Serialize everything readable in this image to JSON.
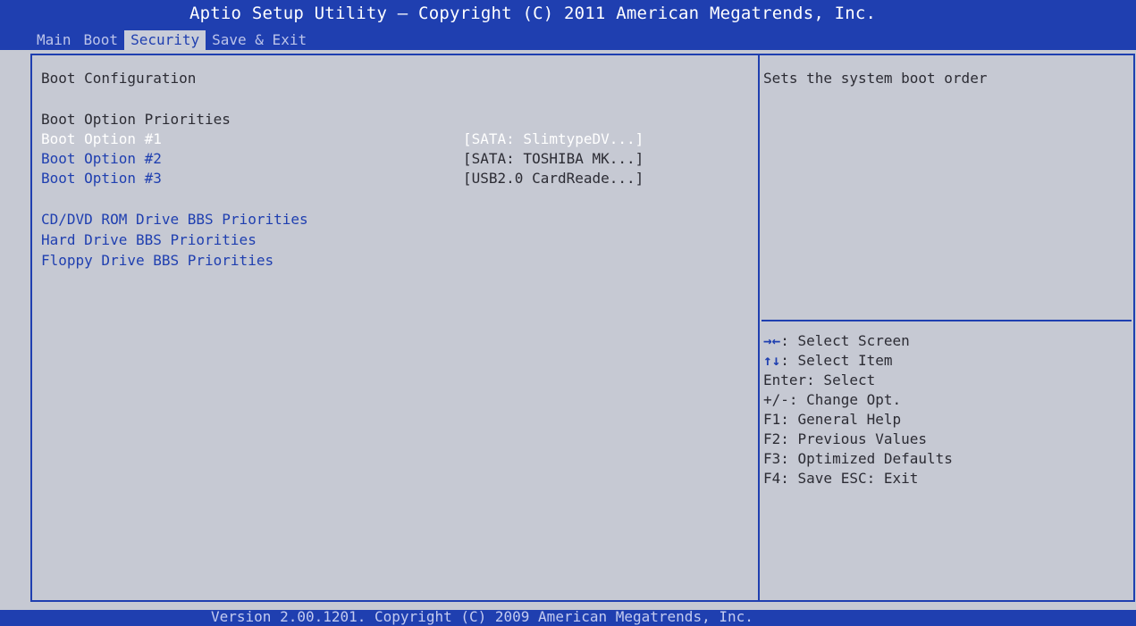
{
  "header": {
    "title": "Aptio Setup Utility – Copyright (C) 2011 American Megatrends, Inc.",
    "tabs": [
      "Main",
      "Boot",
      "Security",
      "Save & Exit"
    ],
    "active_tab": "Security"
  },
  "main": {
    "section_title": "Boot Configuration",
    "priorities_heading": "Boot Option Priorities",
    "boot_options": [
      {
        "label": "Boot Option #1",
        "value": "[SATA: SlimtypeDV...]",
        "selected": true
      },
      {
        "label": "Boot Option #2",
        "value": "[SATA: TOSHIBA MK...]",
        "selected": false
      },
      {
        "label": "Boot Option #3",
        "value": "[USB2.0 CardReade...]",
        "selected": false
      }
    ],
    "bbs_items": [
      "CD/DVD ROM Drive BBS Priorities",
      "Hard Drive BBS Priorities",
      "Floppy Drive BBS Priorities"
    ]
  },
  "help": {
    "description": "Sets the system boot order",
    "keys": [
      {
        "key": "→←",
        "text": ": Select Screen"
      },
      {
        "key": "↑↓",
        "text": ": Select Item"
      },
      {
        "key": "",
        "text": "Enter: Select"
      },
      {
        "key": "",
        "text": "+/-: Change Opt."
      },
      {
        "key": "",
        "text": "F1: General Help"
      },
      {
        "key": "",
        "text": "F2: Previous Values"
      },
      {
        "key": "",
        "text": "F3: Optimized Defaults"
      },
      {
        "key": "",
        "text": "F4: Save  ESC: Exit"
      }
    ]
  },
  "footer": {
    "text": "Version 2.00.1201. Copyright (C) 2009 American Megatrends, Inc."
  },
  "colors": {
    "header_blue": "#1f3fb0",
    "panel_gray": "#c6c9d3",
    "selected_text": "#ffffff"
  }
}
